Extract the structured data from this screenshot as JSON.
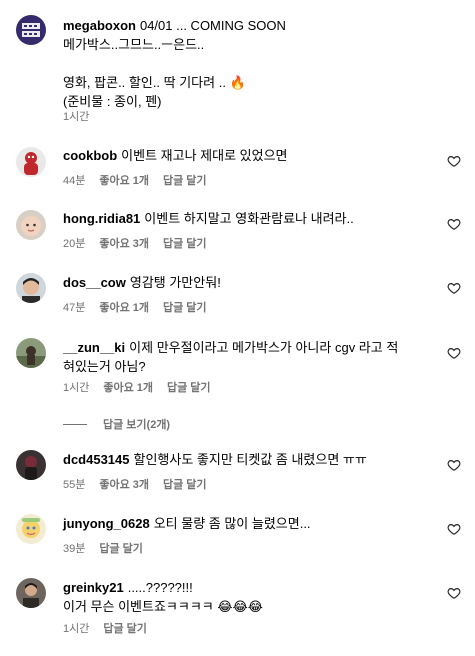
{
  "post": {
    "username": "megaboxon",
    "lines": [
      "04/01 ... COMING SOON",
      "메가박스..그므느..ㅡ은드..",
      "",
      "영화, 팝콘.. 할인.. 딱 기다려 ..",
      "(준비물 : 종이, 펜)"
    ],
    "fire_emoji": "🔥",
    "time": "1시간",
    "avatar_text": "MEGA BOX"
  },
  "comments": [
    {
      "username": "cookbob",
      "text": "이벤트 재고나 제대로 있었으면",
      "time": "44분",
      "likes": "좋아요 1개",
      "reply": "답글 달기",
      "avatar_icon": "avatar-red-figure"
    },
    {
      "username": "hong.ridia81",
      "text": "이벤트 하지말고 영화관람료나 내려라..",
      "time": "20분",
      "likes": "좋아요 3개",
      "reply": "답글 달기",
      "avatar_icon": "avatar-baby-face"
    },
    {
      "username": "dos__cow",
      "text": "영감탱 가만안둬!",
      "time": "47분",
      "likes": "좋아요 1개",
      "reply": "답글 달기",
      "avatar_icon": "avatar-man-face"
    },
    {
      "username": "__zun__ki",
      "text_lines": [
        "이제 만우절이라고 메가박스가 아니라 cgv 라고 적",
        "혀있는거 아님?"
      ],
      "time": "1시간",
      "likes": "좋아요 1개",
      "reply": "답글 달기",
      "avatar_icon": "avatar-outdoor-photo"
    },
    {
      "username": "dcd453145",
      "text": "할인행사도 좋지만 티켓값 좀 내렸으면 ㅠㅠ",
      "time": "55분",
      "likes": "좋아요 3개",
      "reply": "답글 달기",
      "avatar_icon": "avatar-dark-person"
    },
    {
      "username": "junyong_0628",
      "text": "오티 물량 좀 많이 늘렸으면...",
      "time": "39분",
      "likes": "",
      "reply": "답글 달기",
      "avatar_icon": "avatar-cartoon-character"
    },
    {
      "username": "greinky21",
      "text_lines": [
        ".....?????!!!",
        "이거 무슨 이벤트죠ㅋㅋㅋㅋ"
      ],
      "emojis": "😂😂😂",
      "time": "1시간",
      "likes": "",
      "reply": "답글 달기",
      "avatar_icon": "avatar-person-photo"
    }
  ],
  "view_replies": "답글 보기(2개)",
  "colors": {
    "meta": "#737373",
    "text": "#000000",
    "background": "#ffffff"
  },
  "icons": {
    "like": "heart-icon"
  }
}
